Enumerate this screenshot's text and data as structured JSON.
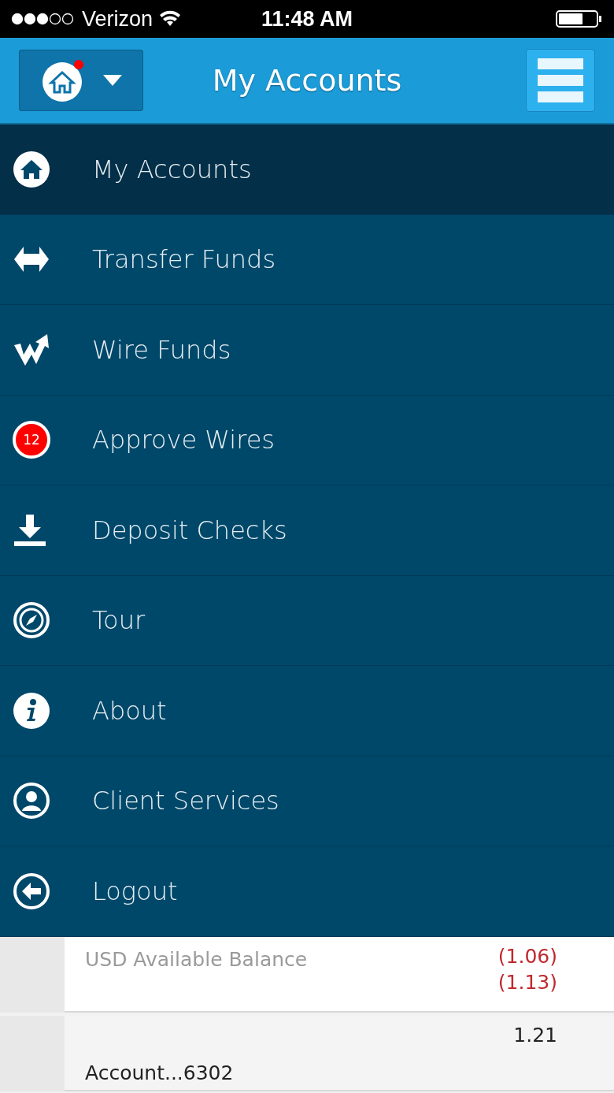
{
  "status_bar": {
    "carrier": "Verizon",
    "time": "11:48 AM"
  },
  "header": {
    "title": "My Accounts"
  },
  "menu": [
    {
      "label": "My Accounts",
      "selected": true
    },
    {
      "label": "Transfer Funds",
      "selected": false
    },
    {
      "label": "Wire Funds",
      "selected": false
    },
    {
      "label": "Approve Wires",
      "selected": false,
      "badge": "12"
    },
    {
      "label": "Deposit Checks",
      "selected": false
    },
    {
      "label": "Tour",
      "selected": false
    },
    {
      "label": "About",
      "selected": false
    },
    {
      "label": "Client Services",
      "selected": false
    },
    {
      "label": "Logout",
      "selected": false
    }
  ],
  "accounts": [
    {
      "label": "USD Available Balance",
      "values": [
        "(1.06)",
        "(1.13)"
      ],
      "negative": true
    },
    {
      "label": "Account...6302",
      "values": [
        "1.21"
      ],
      "negative": false
    }
  ]
}
